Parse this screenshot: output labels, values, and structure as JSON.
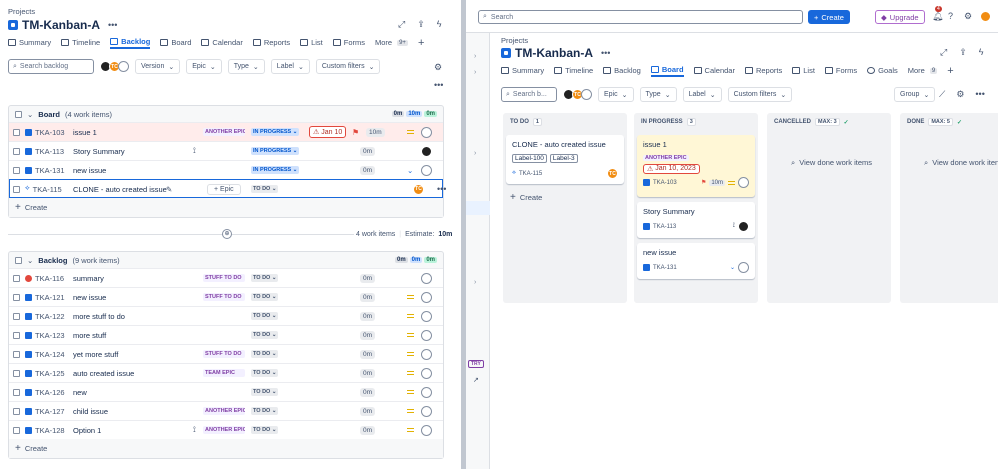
{
  "left": {
    "breadcrumb": "Projects",
    "title": "TM-Kanban-A",
    "tabs": [
      {
        "label": "Summary"
      },
      {
        "label": "Timeline"
      },
      {
        "label": "Backlog"
      },
      {
        "label": "Board"
      },
      {
        "label": "Calendar"
      },
      {
        "label": "Reports"
      },
      {
        "label": "List"
      },
      {
        "label": "Forms"
      },
      {
        "label": "More",
        "count": "9+"
      }
    ],
    "filters": {
      "search_placeholder": "Search backlog",
      "avatar_initials": "TC",
      "version": "Version",
      "epic": "Epic",
      "type": "Type",
      "label": "Label",
      "custom": "Custom filters"
    },
    "board_section": {
      "name": "Board",
      "count": "(4 work items)",
      "stats": [
        "0m",
        "10m",
        "0m"
      ],
      "rows": [
        {
          "key": "TKA-103",
          "summary": "issue 1",
          "epic": "ANOTHER EPIC",
          "status": "IN PROGRESS",
          "due": "Jan 10",
          "estimate": "10m",
          "flag": true
        },
        {
          "key": "TKA-113",
          "summary": "Story Summary",
          "status": "IN PROGRESS",
          "estimate": "0m"
        },
        {
          "key": "TKA-131",
          "summary": "new issue",
          "status": "IN PROGRESS",
          "estimate": "0m"
        },
        {
          "key": "TKA-115",
          "summary": "CLONE - auto created issue",
          "epic_action": "+ Epic",
          "status": "TO DO",
          "avatar": "TC"
        }
      ],
      "create": "Create"
    },
    "divider": {
      "count": "4 work items",
      "estimate_label": "Estimate:",
      "estimate": "10m"
    },
    "backlog_section": {
      "name": "Backlog",
      "count": "(9 work items)",
      "stats": [
        "0m",
        "0m",
        "0m"
      ],
      "rows": [
        {
          "key": "TKA-116",
          "summary": "summary",
          "epic": "STUFF TO DO",
          "status": "TO DO",
          "estimate": "0m"
        },
        {
          "key": "TKA-121",
          "summary": "new issue",
          "epic": "STUFF TO DO",
          "status": "TO DO",
          "estimate": "0m"
        },
        {
          "key": "TKA-122",
          "summary": "more stuff to do",
          "status": "TO DO",
          "estimate": "0m"
        },
        {
          "key": "TKA-123",
          "summary": "more stuff",
          "status": "TO DO",
          "estimate": "0m"
        },
        {
          "key": "TKA-124",
          "summary": "yet more stuff",
          "epic": "STUFF TO DO",
          "status": "TO DO",
          "estimate": "0m"
        },
        {
          "key": "TKA-125",
          "summary": "auto created issue",
          "epic": "TEAM EPIC",
          "status": "TO DO",
          "estimate": "0m"
        },
        {
          "key": "TKA-126",
          "summary": "new",
          "status": "TO DO",
          "estimate": "0m"
        },
        {
          "key": "TKA-127",
          "summary": "child issue",
          "epic": "ANOTHER EPIC",
          "status": "TO DO",
          "estimate": "0m"
        },
        {
          "key": "TKA-128",
          "summary": "Option 1",
          "epic": "ANOTHER EPIC",
          "status": "TO DO",
          "estimate": "0m"
        }
      ],
      "create": "Create"
    }
  },
  "right": {
    "search_placeholder": "Search",
    "create_button": "Create",
    "upgrade_button": "Upgrade",
    "notification_count": "4",
    "breadcrumb": "Projects",
    "title": "TM-Kanban-A",
    "tabs": [
      {
        "label": "Summary"
      },
      {
        "label": "Timeline"
      },
      {
        "label": "Backlog"
      },
      {
        "label": "Board"
      },
      {
        "label": "Calendar"
      },
      {
        "label": "Reports"
      },
      {
        "label": "List"
      },
      {
        "label": "Forms"
      },
      {
        "label": "Goals"
      },
      {
        "label": "More",
        "count": "9"
      }
    ],
    "filters": {
      "search_placeholder": "Search b...",
      "avatar_initials": "TC",
      "epic": "Epic",
      "type": "Type",
      "label": "Label",
      "custom": "Custom filters",
      "group": "Group"
    },
    "side_badge": "TRY",
    "columns": [
      {
        "name": "TO DO",
        "count": "1"
      },
      {
        "name": "IN PROGRESS",
        "count": "3"
      },
      {
        "name": "CANCELLED",
        "count": "MAX: 3"
      },
      {
        "name": "DONE",
        "count": "MAX: 5"
      }
    ],
    "todo_card": {
      "title": "CLONE - auto created issue",
      "labels": [
        "Label-100",
        "Label-3"
      ],
      "key": "TKA-115",
      "avatar": "TC"
    },
    "todo_create": "Create",
    "inprogress_cards": [
      {
        "title": "issue 1",
        "epic": "ANOTHER EPIC",
        "due": "Jan 10, 2023",
        "key": "TKA-103",
        "estimate": "10m"
      },
      {
        "title": "Story Summary",
        "key": "TKA-113"
      },
      {
        "title": "new issue",
        "key": "TKA-131"
      }
    ],
    "view_done": "View done work items",
    "view_done_cut": "View done work iten"
  },
  "colors": {
    "accent": "#1868db",
    "danger": "#e2483d",
    "epic": "#803fa5",
    "warning": "#e2b203"
  }
}
